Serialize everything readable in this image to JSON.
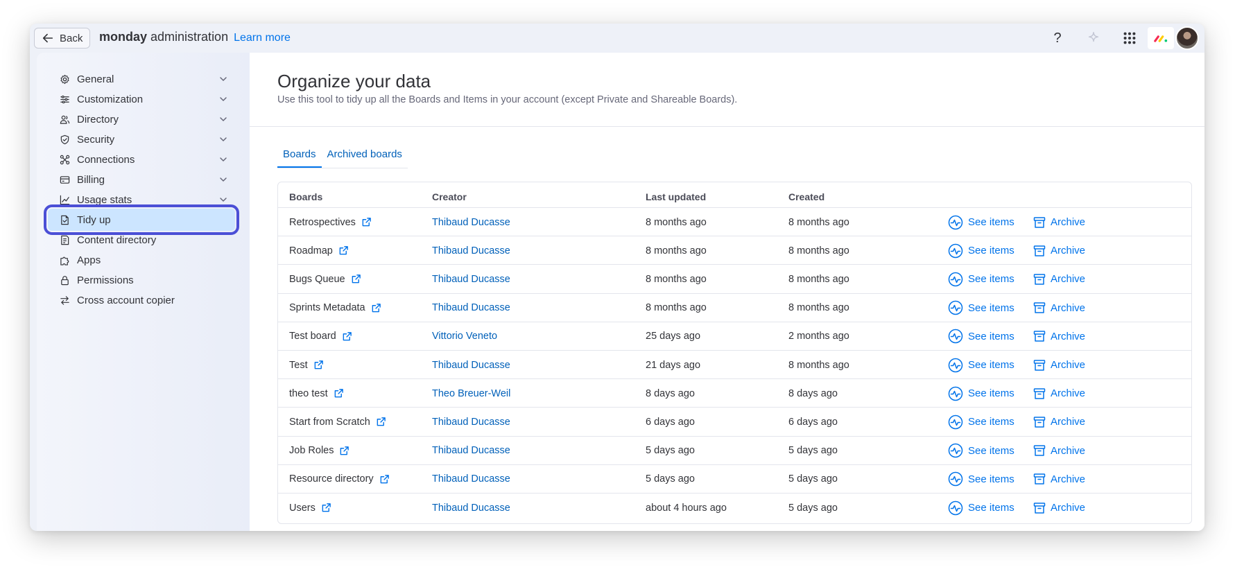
{
  "topbar": {
    "back_label": "Back",
    "brand_bold": "monday",
    "brand_rest": "administration",
    "learn_more": "Learn more",
    "help_label": "?"
  },
  "sidebar": {
    "items": [
      {
        "label": "General",
        "icon": "gear-icon",
        "expandable": true
      },
      {
        "label": "Customization",
        "icon": "sliders-icon",
        "expandable": true
      },
      {
        "label": "Directory",
        "icon": "users-icon",
        "expandable": true
      },
      {
        "label": "Security",
        "icon": "shield-icon",
        "expandable": true
      },
      {
        "label": "Connections",
        "icon": "connections-icon",
        "expandable": true
      },
      {
        "label": "Billing",
        "icon": "credit-card-icon",
        "expandable": true
      },
      {
        "label": "Usage stats",
        "icon": "chart-icon",
        "expandable": true
      },
      {
        "label": "Tidy up",
        "icon": "tidy-icon",
        "expandable": false,
        "active": true
      },
      {
        "label": "Content directory",
        "icon": "content-icon",
        "expandable": false
      },
      {
        "label": "Apps",
        "icon": "puzzle-icon",
        "expandable": false
      },
      {
        "label": "Permissions",
        "icon": "lock-icon",
        "expandable": false
      },
      {
        "label": "Cross account copier",
        "icon": "swap-icon",
        "expandable": false
      }
    ]
  },
  "main": {
    "title": "Organize your data",
    "subtitle": "Use this tool to tidy up all the Boards and Items in your account (except Private and Shareable Boards).",
    "tabs": [
      {
        "label": "Boards",
        "active": true
      },
      {
        "label": "Archived boards",
        "active": false
      }
    ],
    "table": {
      "headers": {
        "boards": "Boards",
        "creator": "Creator",
        "updated": "Last updated",
        "created": "Created"
      },
      "action_see": "See items",
      "action_archive": "Archive",
      "rows": [
        {
          "board": "Retrospectives",
          "creator": "Thibaud Ducasse",
          "updated": "8 months ago",
          "created": "8 months ago"
        },
        {
          "board": "Roadmap",
          "creator": "Thibaud Ducasse",
          "updated": "8 months ago",
          "created": "8 months ago"
        },
        {
          "board": "Bugs Queue",
          "creator": "Thibaud Ducasse",
          "updated": "8 months ago",
          "created": "8 months ago"
        },
        {
          "board": "Sprints Metadata",
          "creator": "Thibaud Ducasse",
          "updated": "8 months ago",
          "created": "8 months ago"
        },
        {
          "board": "Test board",
          "creator": "Vittorio Veneto",
          "updated": "25 days ago",
          "created": "2 months ago"
        },
        {
          "board": "Test",
          "creator": "Thibaud Ducasse",
          "updated": "21 days ago",
          "created": "8 months ago"
        },
        {
          "board": "theo test",
          "creator": "Theo Breuer-Weil",
          "updated": "8 days ago",
          "created": "8 days ago"
        },
        {
          "board": "Start from Scratch",
          "creator": "Thibaud Ducasse",
          "updated": "6 days ago",
          "created": "6 days ago"
        },
        {
          "board": "Job Roles",
          "creator": "Thibaud Ducasse",
          "updated": "5 days ago",
          "created": "5 days ago"
        },
        {
          "board": "Resource directory",
          "creator": "Thibaud Ducasse",
          "updated": "5 days ago",
          "created": "5 days ago"
        },
        {
          "board": "Users",
          "creator": "Thibaud Ducasse",
          "updated": "about 4 hours ago",
          "created": "5 days ago"
        }
      ]
    }
  },
  "colors": {
    "accent": "#0073ea",
    "link": "#0060b9",
    "active_bg": "#cce5ff",
    "highlight_outline": "#4b4fd6"
  }
}
